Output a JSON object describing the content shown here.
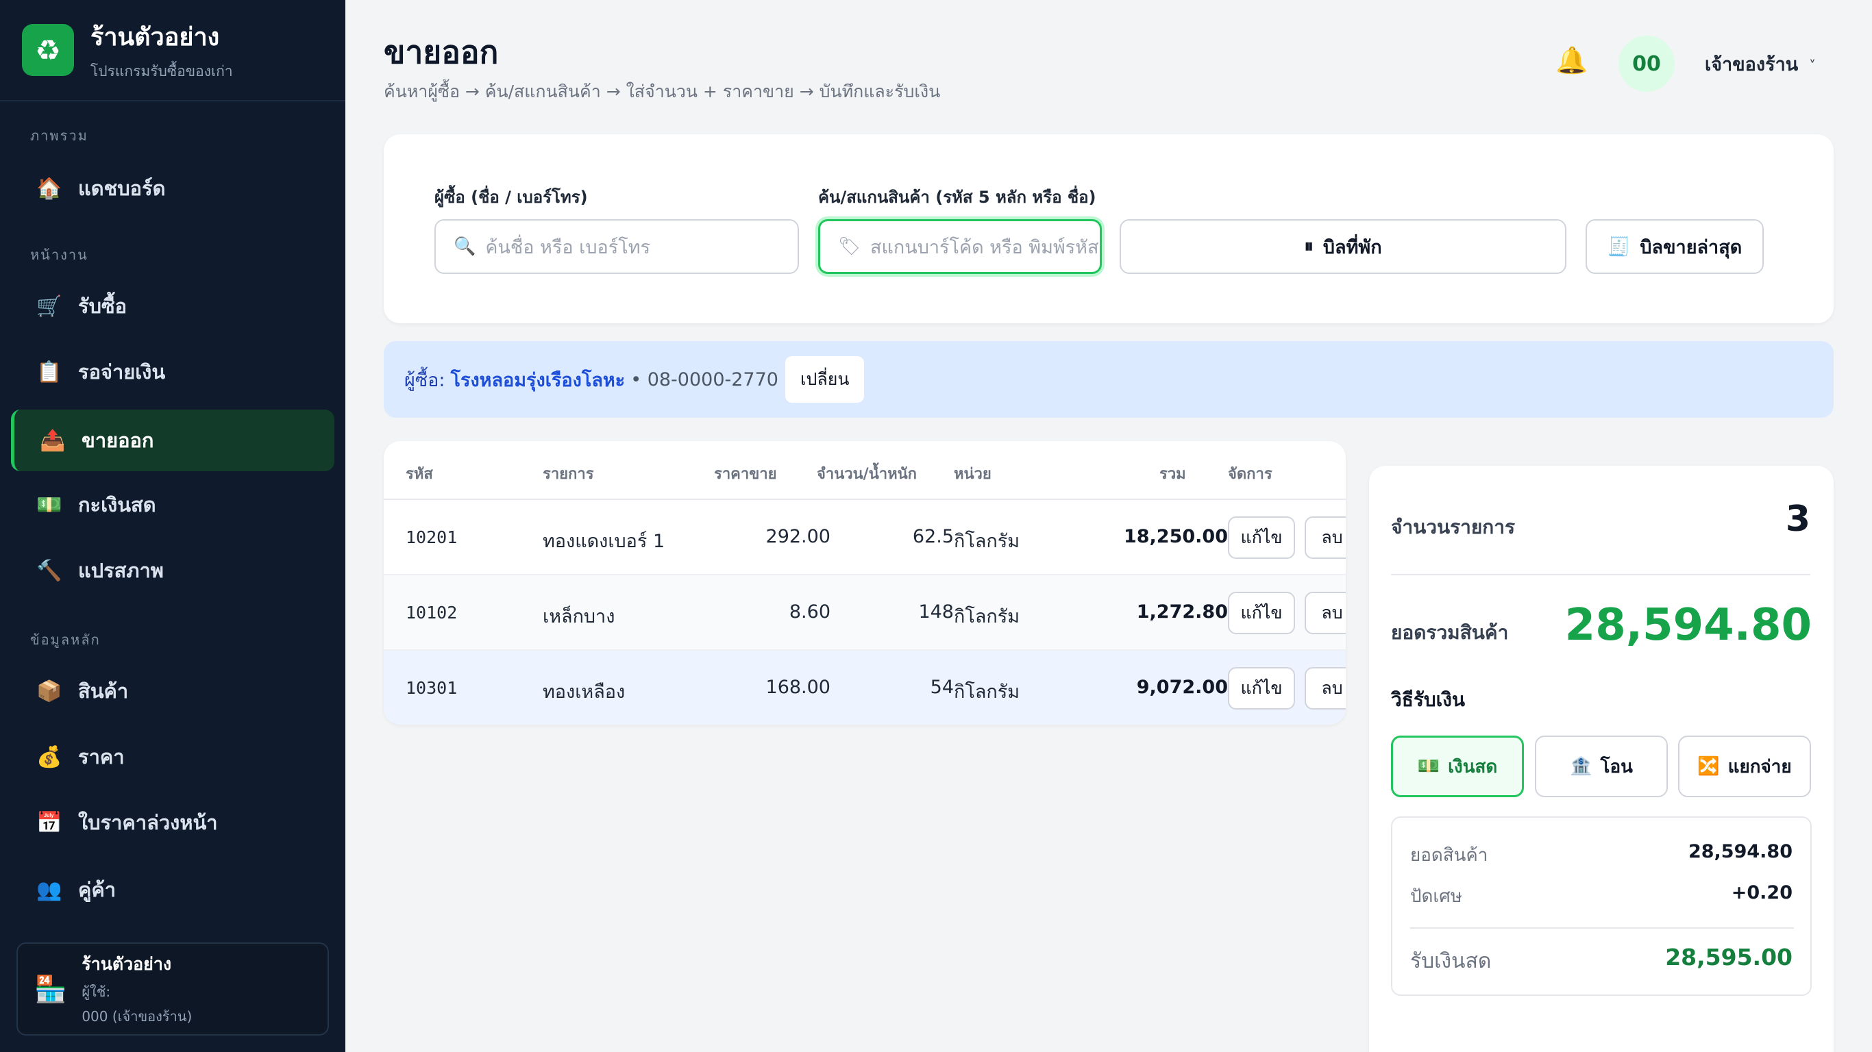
{
  "brand": {
    "title": "ร้านตัวอย่าง",
    "subtitle": "โปรแกรมรับซื้อของเก่า"
  },
  "sidebar": {
    "sections": [
      "ภาพรวม",
      "หน้างาน",
      "ข้อมูลหลัก"
    ],
    "items": [
      {
        "label": "แดชบอร์ด",
        "icon": "🏠"
      },
      {
        "label": "รับซื้อ",
        "icon": "🛒"
      },
      {
        "label": "รอจ่ายเงิน",
        "icon": "📋"
      },
      {
        "label": "ขายออก",
        "icon": "📤"
      },
      {
        "label": "กะเงินสด",
        "icon": "💵"
      },
      {
        "label": "แปรสภาพ",
        "icon": "🔨"
      },
      {
        "label": "สินค้า",
        "icon": "📦"
      },
      {
        "label": "ราคา",
        "icon": "💰"
      },
      {
        "label": "ใบราคาล่วงหน้า",
        "icon": "📅"
      },
      {
        "label": "คู่ค้า",
        "icon": "👥"
      }
    ],
    "user": {
      "name": "ร้านตัวอย่าง",
      "line1": "ผู้ใช้:",
      "line2": "000 (เจ้าของร้าน)"
    }
  },
  "header": {
    "title": "ขายออก",
    "subtitle": "ค้นหาผู้ซื้อ → ค้น/สแกนสินค้า → ใส่จำนวน + ราคาขาย → บันทึกและรับเงิน",
    "avatar": "00",
    "owner": "เจ้าของร้าน",
    "chevron": "˅"
  },
  "search": {
    "buyer_label": "ผู้ซื้อ (ชื่อ / เบอร์โทร)",
    "buyer_placeholder": "ค้นชื่อ หรือ เบอร์โทร",
    "product_label": "ค้น/สแกนสินค้า (รหัส 5 หลัก หรือ ชื่อ)",
    "product_placeholder": "สแกนบาร์โค้ด หรือ พิมพ์รหัส",
    "hold_label": "บิลที่พัก",
    "latest_label": "บิลขายล่าสุด"
  },
  "buyer": {
    "label": "ผู้ซื้อ:",
    "name": "โรงหลอมรุ่งเรืองโลหะ",
    "phone": "• 08-0000-2770",
    "change": "เปลี่ยน"
  },
  "table": {
    "headers": [
      "รหัส",
      "รายการ",
      "ราคาขาย",
      "จำนวน/น้ำหนัก",
      "หน่วย",
      "รวม",
      "จัดการ"
    ],
    "rows": [
      {
        "code": "10201",
        "item": "ทองแดงเบอร์ 1",
        "price": "292.00",
        "qty": "62.5",
        "unit": "กิโลกรัม",
        "total": "18,250.00",
        "edit": "แก้ไข",
        "del": "ลบ"
      },
      {
        "code": "10102",
        "item": "เหล็กบาง",
        "price": "8.60",
        "qty": "148",
        "unit": "กิโลกรัม",
        "total": "1,272.80",
        "edit": "แก้ไข",
        "del": "ลบ"
      },
      {
        "code": "10301",
        "item": "ทองเหลือง",
        "price": "168.00",
        "qty": "54",
        "unit": "กิโลกรัม",
        "total": "9,072.00",
        "edit": "แก้ไข",
        "del": "ลบ"
      }
    ]
  },
  "summary": {
    "count_label": "จำนวนรายการ",
    "count": "3",
    "total_label": "ยอดรวมสินค้า",
    "total": "28,594.80",
    "method_label": "วิธีรับเงิน",
    "methods": [
      {
        "label": "เงินสด",
        "icon": "💵"
      },
      {
        "label": "โอน",
        "icon": "🏦"
      },
      {
        "label": "แยกจ่าย",
        "icon": "🔀"
      }
    ],
    "subtotal_label": "ยอดสินค้า",
    "subtotal": "28,594.80",
    "rounding_label": "ปัดเศษ",
    "rounding": "+0.20",
    "cash_label": "รับเงินสด",
    "cash": "28,595.00"
  },
  "colors": {
    "accent": "#22c55e",
    "sidebar_bg": "#0f1b2d",
    "total_green": "#16a34a",
    "buyer_bg": "#dbeafe"
  }
}
